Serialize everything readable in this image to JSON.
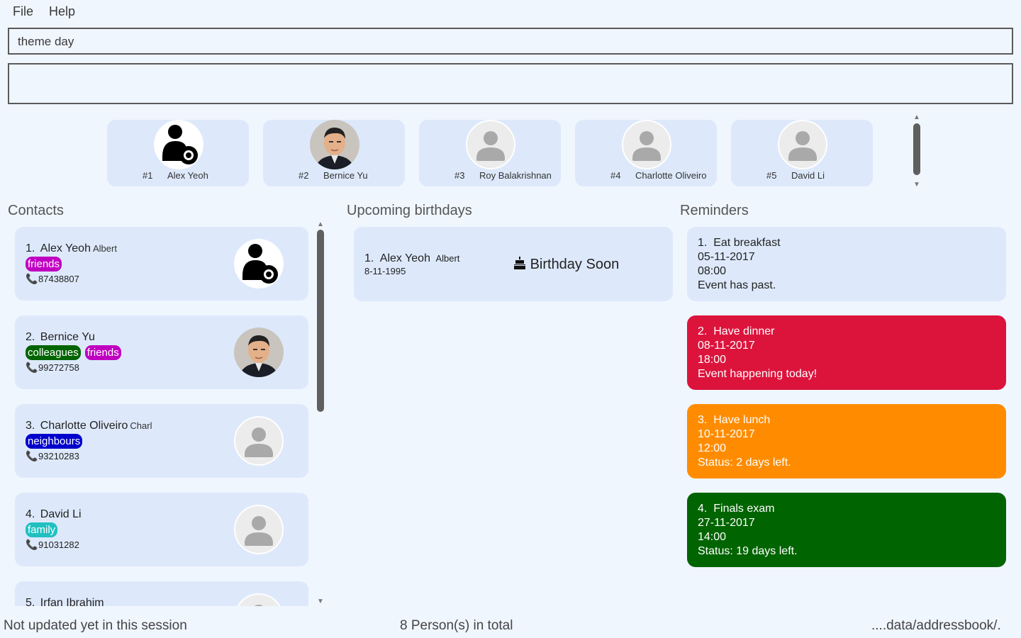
{
  "menu": {
    "file": "File",
    "help": "Help"
  },
  "command": {
    "value": "theme day"
  },
  "result": {
    "text": ""
  },
  "favorites": [
    {
      "rank": "#1",
      "name": "Alex Yeoh"
    },
    {
      "rank": "#2",
      "name": "Bernice Yu"
    },
    {
      "rank": "#3",
      "name": "Roy Balakrishnan"
    },
    {
      "rank": "#4",
      "name": "Charlotte Oliveiro"
    },
    {
      "rank": "#5",
      "name": "David Li"
    }
  ],
  "sections": {
    "contacts": "Contacts",
    "birthdays": "Upcoming birthdays",
    "reminders": "Reminders"
  },
  "contacts": [
    {
      "index": "1.",
      "name": "Alex Yeoh",
      "alias": "Albert",
      "tags": [
        "friends"
      ],
      "phone": "87438807",
      "avatar": "gear-person"
    },
    {
      "index": "2.",
      "name": "Bernice Yu",
      "alias": "",
      "tags": [
        "colleagues",
        "friends"
      ],
      "phone": "99272758",
      "avatar": "photo"
    },
    {
      "index": "3.",
      "name": "Charlotte Oliveiro",
      "alias": "Charl",
      "tags": [
        "neighbours"
      ],
      "phone": "93210283",
      "avatar": "default"
    },
    {
      "index": "4.",
      "name": "David Li",
      "alias": "",
      "tags": [
        "family"
      ],
      "phone": "91031282",
      "avatar": "default"
    },
    {
      "index": "5.",
      "name": "Irfan Ibrahim",
      "alias": "",
      "tags": [],
      "phone": "",
      "avatar": "default"
    }
  ],
  "tag_colors": {
    "friends": "#c000c0",
    "colleagues": "#006400",
    "neighbours": "#0000cd",
    "family": "#20c0c0"
  },
  "birthdays": [
    {
      "index": "1.",
      "name": "Alex Yeoh",
      "alias": "Albert",
      "date": "8-11-1995",
      "badge": "Birthday Soon",
      "icon": "cake-icon"
    }
  ],
  "reminders": [
    {
      "index": "1.",
      "title": "Eat breakfast",
      "date": "05-11-2017",
      "time": "08:00",
      "status": "Event has past.",
      "color": "#dde9fb",
      "text_color": "#222222"
    },
    {
      "index": "2.",
      "title": "Have dinner",
      "date": "08-11-2017",
      "time": "18:00",
      "status": "Event happening today!",
      "color": "#dc143c",
      "text_color": "#ffffff"
    },
    {
      "index": "3.",
      "title": "Have lunch",
      "date": "10-11-2017",
      "time": "12:00",
      "status": "Status: 2 days left.",
      "color": "#ff8c00",
      "text_color": "#ffffff"
    },
    {
      "index": "4.",
      "title": "Finals exam",
      "date": "27-11-2017",
      "time": "14:00",
      "status": "Status: 19 days left.",
      "color": "#006400",
      "text_color": "#ffffff"
    }
  ],
  "status_bar": {
    "sync": "Not updated yet in this session",
    "total": "8 Person(s) in total",
    "path": "....data/addressbook/."
  }
}
